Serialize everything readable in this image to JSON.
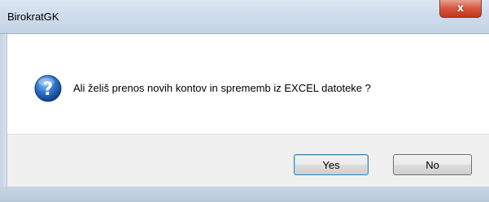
{
  "window": {
    "title": "BirokratGK",
    "close_glyph": "x",
    "icon": "question-icon"
  },
  "dialog": {
    "message": "Ali želiš prenos novih kontov in sprememb iz EXCEL datoteke ?",
    "buttons": {
      "yes_label": "Yes",
      "no_label": "No"
    }
  },
  "colors": {
    "close_button": "#d7553f",
    "icon_blue": "#1f5fb0",
    "focus_border": "#3c7fb1"
  }
}
